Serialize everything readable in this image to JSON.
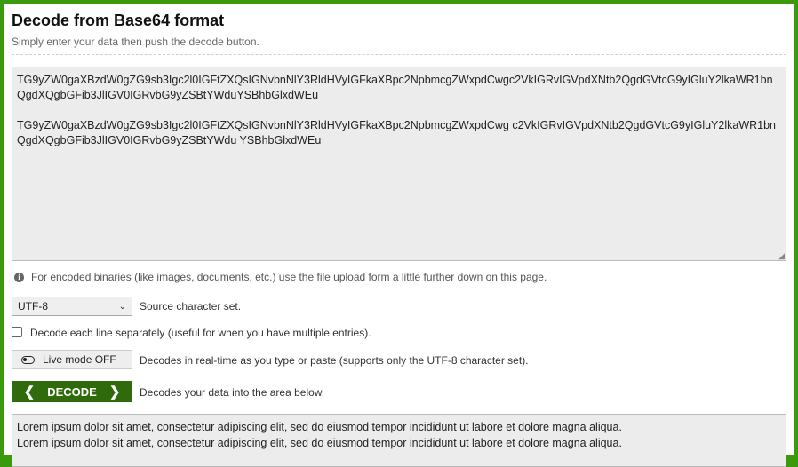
{
  "header": {
    "title": "Decode from Base64 format",
    "subtitle": "Simply enter your data then push the decode button."
  },
  "input": {
    "text": "TG9yZW0gaXBzdW0gZG9sb3Igc2l0IGFtZXQsIGNvbnNlY3RldHVyIGFkaXBpc2NpbmcgZWxpdCwgc2VkIGRvIGVpdXNtb2QgdGVtcG9yIGluY2lkaWR1bnQgdXQgbGFib3JlIGV0IGRvbG9yZSBtYWduYSBhbGlxdWEu\n\nTG9yZW0gaXBzdW0gZG9sb3Igc2l0IGFtZXQsIGNvbnNlY3RldHVyIGFkaXBpc2NpbmcgZWxpdCwg c2VkIGRvIGVpdXNtb2QgdGVtcG9yIGluY2lkaWR1bnQgdXQgbGFib3JlIGV0IGRvbG9yZSBtYWdu YSBhbGlxdWEu"
  },
  "info": {
    "icon": "info-icon",
    "text": "For encoded binaries (like images, documents, etc.) use the file upload form a little further down on this page."
  },
  "charset": {
    "selected": "UTF-8",
    "label": "Source character set."
  },
  "options": {
    "each_line_label": "Decode each line separately (useful for when you have multiple entries).",
    "each_line_checked": false
  },
  "live_mode": {
    "button_label": "Live mode OFF",
    "description": "Decodes in real-time as you type or paste (supports only the UTF-8 character set)."
  },
  "decode": {
    "button_label": "DECODE",
    "description": "Decodes your data into the area below."
  },
  "output": {
    "lines": [
      "Lorem ipsum dolor sit amet, consectetur adipiscing elit, sed do eiusmod tempor incididunt ut labore et dolore magna aliqua.",
      "Lorem ipsum dolor sit amet, consectetur adipiscing elit, sed do eiusmod tempor incididunt ut labore et dolore magna aliqua."
    ]
  },
  "colors": {
    "brand_green": "#3b9a0b",
    "button_green": "#2f6b0d"
  }
}
